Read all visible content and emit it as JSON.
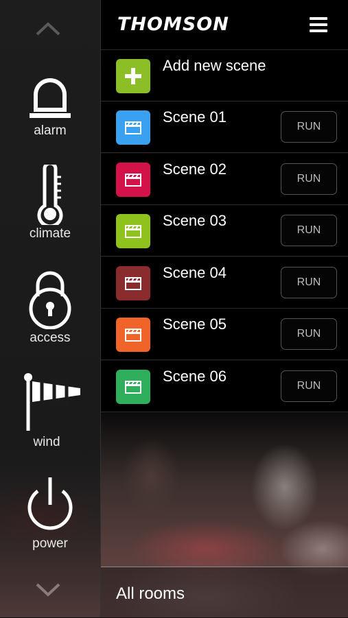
{
  "brand": {
    "name": "THOMSON"
  },
  "colors": {
    "add": "#8cbf26",
    "scene01": "#3aa0f0",
    "scene02": "#d4124a",
    "scene03": "#8fc21c",
    "scene04": "#8a2b2e",
    "scene05": "#f0642a",
    "scene06": "#2fae5c"
  },
  "sidebar": {
    "items": [
      {
        "label": "alarm",
        "icon": "alarm-icon"
      },
      {
        "label": "climate",
        "icon": "thermometer-icon"
      },
      {
        "label": "access",
        "icon": "padlock-icon"
      },
      {
        "label": "wind",
        "icon": "windsock-icon"
      },
      {
        "label": "power",
        "icon": "power-icon"
      }
    ]
  },
  "add_scene": {
    "label": "Add new scene",
    "icon": "plus-icon"
  },
  "scenes": [
    {
      "label": "Scene 01",
      "run_label": "RUN",
      "icon": "clapperboard-icon"
    },
    {
      "label": "Scene 02",
      "run_label": "RUN",
      "icon": "clapperboard-icon"
    },
    {
      "label": "Scene 03",
      "run_label": "RUN",
      "icon": "clapperboard-icon"
    },
    {
      "label": "Scene 04",
      "run_label": "RUN",
      "icon": "clapperboard-icon"
    },
    {
      "label": "Scene 05",
      "run_label": "RUN",
      "icon": "clapperboard-icon"
    },
    {
      "label": "Scene 06",
      "run_label": "RUN",
      "icon": "clapperboard-icon"
    }
  ],
  "footer": {
    "label": "All rooms"
  }
}
